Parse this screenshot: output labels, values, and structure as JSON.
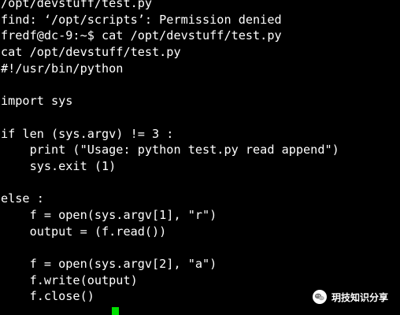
{
  "terminal": {
    "lines": [
      "/opt/devstuff/test.py",
      "find: ‘/opt/scripts’: Permission denied",
      "fredf@dc-9:~$ cat /opt/devstuff/test.py",
      "cat /opt/devstuff/test.py",
      "#!/usr/bin/python",
      "",
      "import sys",
      "",
      "if len (sys.argv) != 3 :",
      "    print (\"Usage: python test.py read append\")",
      "    sys.exit (1)",
      "",
      "else :",
      "    f = open(sys.argv[1], \"r\")",
      "    output = (f.read())",
      "",
      "    f = open(sys.argv[2], \"a\")",
      "    f.write(output)",
      "    f.close()",
      ""
    ],
    "cursor_color": "#00e000",
    "text_color": "#ffffff",
    "background": "#000000"
  },
  "watermark": {
    "text": "玥技知识分享",
    "icon": "wechat-icon"
  }
}
